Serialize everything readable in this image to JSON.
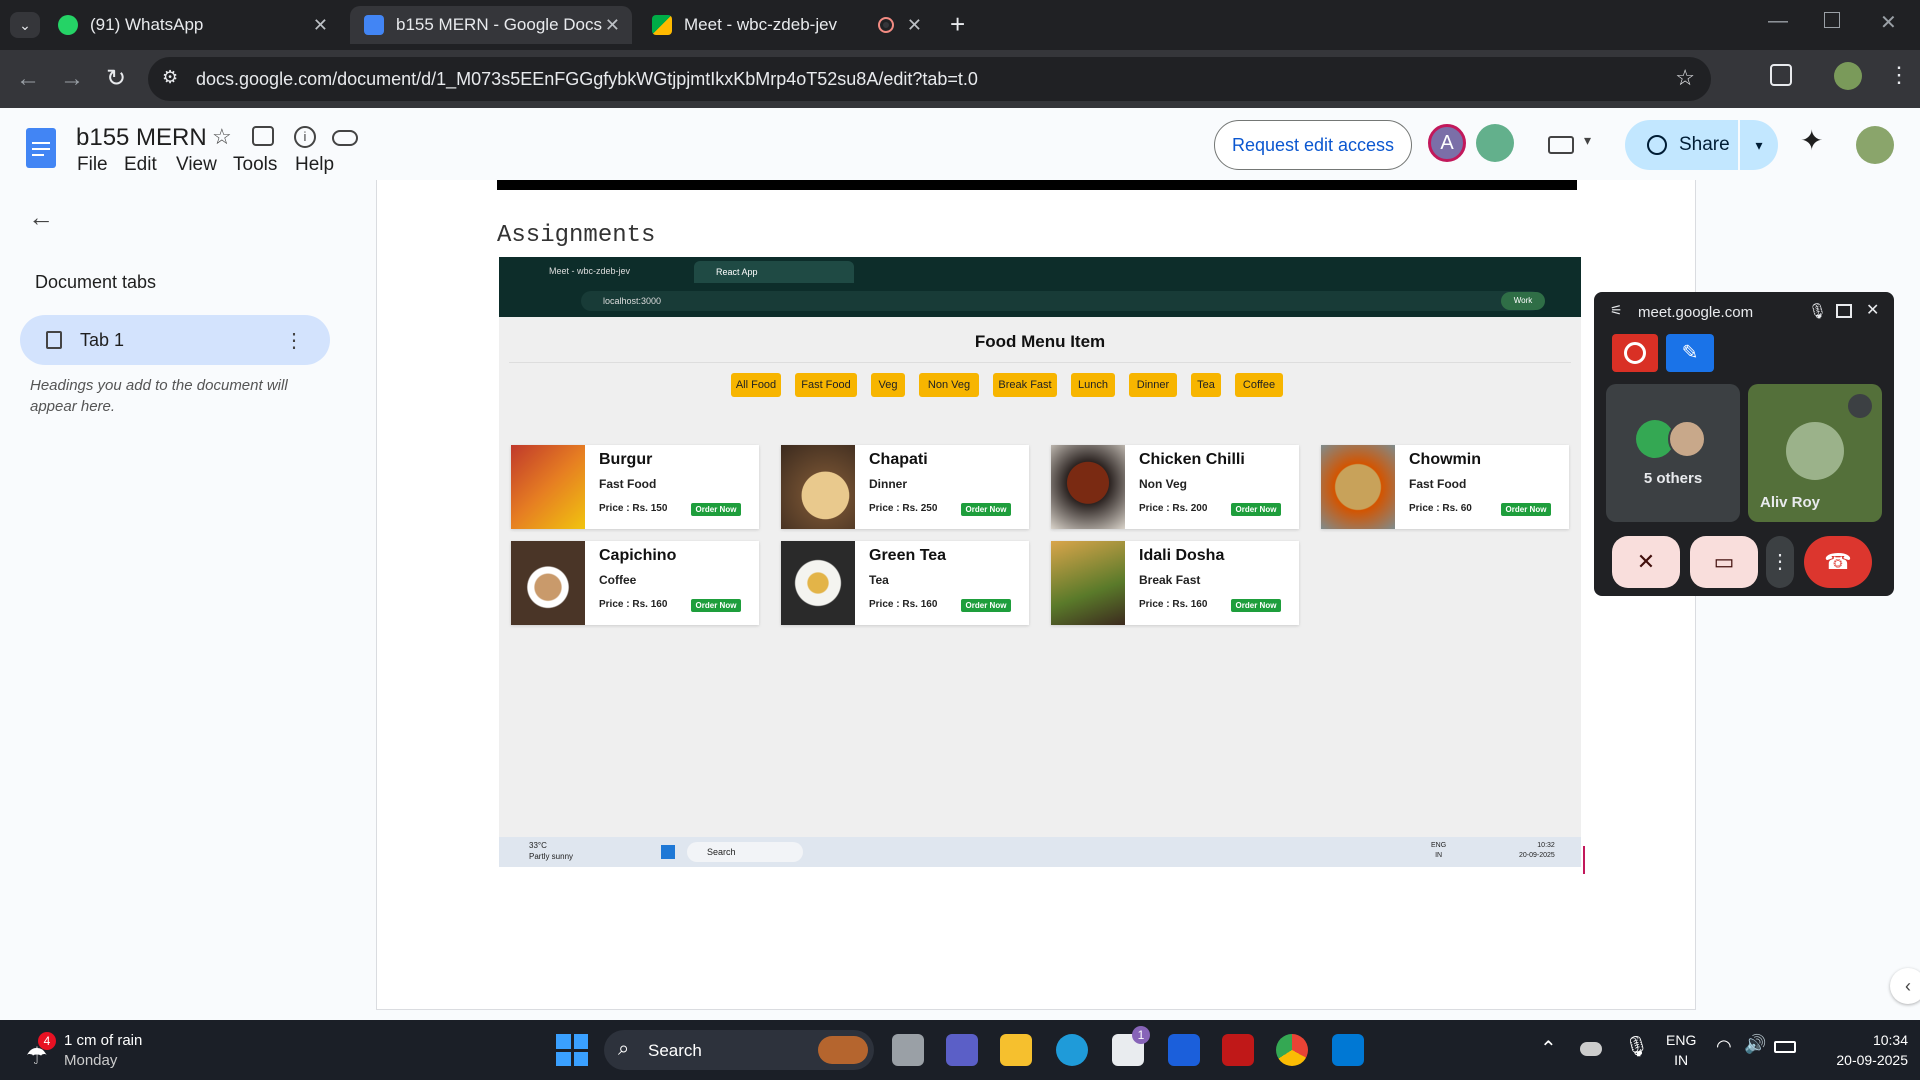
{
  "browser": {
    "tabs": [
      {
        "title": "(91) WhatsApp"
      },
      {
        "title": "b155 MERN - Google Docs"
      },
      {
        "title": "Meet - wbc-zdeb-jev"
      }
    ],
    "url": "docs.google.com/document/d/1_M073s5EEnFGGgfybkWGtjpjmtIkxKbMrp4oT52su8A/edit?tab=t.0"
  },
  "docs": {
    "title": "b155 MERN",
    "menus": [
      "File",
      "Edit",
      "View",
      "Tools",
      "Help"
    ],
    "request_edit": "Request edit access",
    "avatar_letter": "A",
    "share": "Share"
  },
  "sidebar": {
    "heading": "Document tabs",
    "tab_label": "Tab 1",
    "hint": "Headings you add to the document will appear here."
  },
  "document": {
    "section_title": "Assignments"
  },
  "embedded_app": {
    "tabs": [
      "Meet - wbc-zdeb-jev",
      "React App"
    ],
    "url": "localhost:3000",
    "profile": "Work",
    "title": "Food Menu Item",
    "categories": [
      "All Food",
      "Fast Food",
      "Veg",
      "Non Veg",
      "Break Fast",
      "Lunch",
      "Dinner",
      "Tea",
      "Coffee"
    ],
    "order_label": "Order Now",
    "items": [
      {
        "name": "Burgur",
        "category": "Fast Food",
        "price": "Price : Rs. 150"
      },
      {
        "name": "Chapati",
        "category": "Dinner",
        "price": "Price : Rs. 250"
      },
      {
        "name": "Chicken Chilli",
        "category": "Non Veg",
        "price": "Price : Rs. 200"
      },
      {
        "name": "Chowmin",
        "category": "Fast Food",
        "price": "Price : Rs. 60"
      },
      {
        "name": "Capichino",
        "category": "Coffee",
        "price": "Price : Rs. 160"
      },
      {
        "name": "Green Tea",
        "category": "Tea",
        "price": "Price : Rs. 160"
      },
      {
        "name": "Idali Dosha",
        "category": "Break Fast",
        "price": "Price : Rs. 160"
      }
    ],
    "taskbar": {
      "weather_temp": "33°C",
      "weather_desc": "Partly sunny",
      "search": "Search",
      "lang1": "ENG",
      "lang2": "IN",
      "time": "10:32",
      "date": "20-09-2025"
    }
  },
  "meet": {
    "host": "meet.google.com",
    "others": "5 others",
    "participant": "Aliv Roy"
  },
  "taskbar": {
    "weather_badge": "4",
    "weather_line1": "1 cm of rain",
    "weather_line2": "Monday",
    "search": "Search",
    "store_badge": "1",
    "lang1": "ENG",
    "lang2": "IN",
    "time": "10:34",
    "date": "20-09-2025"
  }
}
